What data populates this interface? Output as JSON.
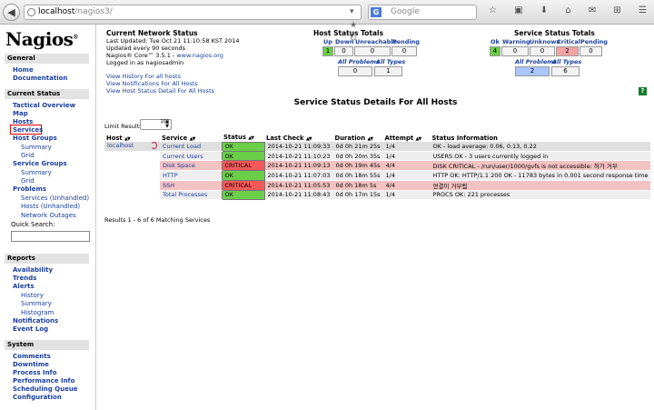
{
  "browser": {
    "url_host": "localhost",
    "url_path": "/nagios3/",
    "search_engine": "G",
    "search_placeholder": "Google"
  },
  "sidebar": {
    "logo": "Nagios",
    "logo_mark": "®",
    "general_title": "General",
    "general": [
      "Home",
      "Documentation"
    ],
    "status_title": "Current Status",
    "tactical": "Tactical Overview",
    "map": "Map",
    "hosts": "Hosts",
    "services": "Services",
    "host_groups": "Host Groups",
    "hg_summary": "Summary",
    "hg_grid": "Grid",
    "service_groups": "Service Groups",
    "sg_summary": "Summary",
    "sg_grid": "Grid",
    "problems": "Problems",
    "pr_services": "Services (Unhandled)",
    "pr_hosts": "Hosts (Unhandled)",
    "pr_outages": "Network Outages",
    "quick_search": "Quick Search:",
    "reports_title": "Reports",
    "availability": "Availability",
    "trends": "Trends",
    "alerts": "Alerts",
    "al_history": "History",
    "al_summary": "Summary",
    "al_histogram": "Histogram",
    "notifications": "Notifications",
    "eventlog": "Event Log",
    "system_title": "System",
    "comments": "Comments",
    "downtime": "Downtime",
    "process_info": "Process Info",
    "perf_info": "Performance Info",
    "sched_queue": "Scheduling Queue",
    "configuration": "Configuration"
  },
  "netstat": {
    "title": "Current Network Status",
    "updated": "Last Updated: Tue Oct 21 11:10:58 KST 2014",
    "interval": "Updated every 90 seconds",
    "core": "Nagios® Core™ 3.5.1 - ",
    "core_link": "www.nagios.org",
    "login": "Logged in as nagiosadmin",
    "links": [
      "View History For all hosts",
      "View Notifications For All Hosts",
      "View Host Status Detail For All Hosts"
    ]
  },
  "host_totals": {
    "title": "Host Status Totals",
    "headers": [
      "Up",
      "Down",
      "Unreachable",
      "Pending"
    ],
    "values": [
      "1",
      "0",
      "0",
      "0"
    ],
    "sub_headers": [
      "All Problems",
      "All Types"
    ],
    "sub_values": [
      "0",
      "1"
    ]
  },
  "service_totals": {
    "title": "Service Status Totals",
    "headers": [
      "Ok",
      "Warning",
      "Unknown",
      "Critical",
      "Pending"
    ],
    "values": [
      "4",
      "0",
      "0",
      "2",
      "0"
    ],
    "sub_headers": [
      "All Problems",
      "All Types"
    ],
    "sub_values": [
      "2",
      "6"
    ]
  },
  "help_icon": "?",
  "main_title": "Service Status Details For All Hosts",
  "limit_label": "Limit Results:",
  "limit_value": "100",
  "columns": [
    "Host",
    "Service",
    "Status",
    "Last Check",
    "Duration",
    "Attempt",
    "Status Information"
  ],
  "sort_arrows": "▲▼",
  "rows": [
    {
      "host": "localhost",
      "service": "Current Load",
      "status": "OK",
      "last_check": "2014-10-21 11:09:33",
      "duration": "0d 0h 21m 25s",
      "attempt": "1/4",
      "info": "OK - load average: 0.06, 0.13, 0.22"
    },
    {
      "host": "",
      "service": "Current Users",
      "status": "OK",
      "last_check": "2014-10-21 11:10:23",
      "duration": "0d 0h 20m 35s",
      "attempt": "1/4",
      "info": "USERS OK - 3 users currently logged in"
    },
    {
      "host": "",
      "service": "Disk Space",
      "status": "CRITICAL",
      "last_check": "2014-10-21 11:09:13",
      "duration": "0d 0h 19m 45s",
      "attempt": "4/4",
      "info": "DISK CRITICAL - /run/user/1000/gvfs is not accessible: 허가 거부"
    },
    {
      "host": "",
      "service": "HTTP",
      "status": "OK",
      "last_check": "2014-10-21 11:07:03",
      "duration": "0d 0h 18m 55s",
      "attempt": "1/4",
      "info": "HTTP OK: HTTP/1.1 200 OK - 11783 bytes in 0.001 second response time"
    },
    {
      "host": "",
      "service": "SSH",
      "status": "CRITICAL",
      "last_check": "2014-10-21 11:05:53",
      "duration": "0d 0h 18m 5s",
      "attempt": "4/4",
      "info": "연결이 거부됨"
    },
    {
      "host": "",
      "service": "Total Processes",
      "status": "OK",
      "last_check": "2014-10-21 11:08:43",
      "duration": "0d 0h 17m 15s",
      "attempt": "1/4",
      "info": "PROCS OK: 221 processes"
    }
  ],
  "results_text": "Results 1 - 6 of 6 Matching Services",
  "colors": {
    "ok": "#6bce48",
    "critical": "#f45858",
    "link": "#193ea0"
  }
}
